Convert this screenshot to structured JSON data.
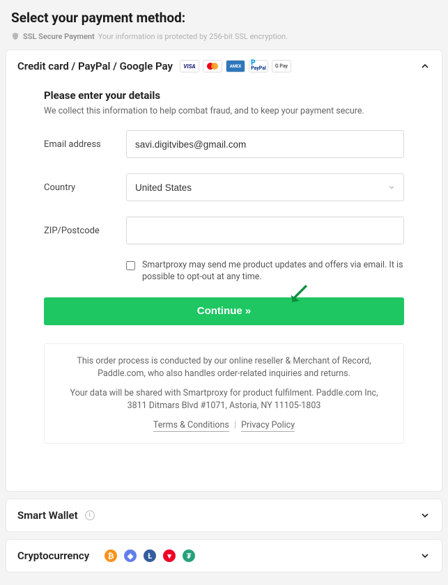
{
  "title": "Select your payment method:",
  "ssl": {
    "label": "SSL Secure Payment",
    "sub": "Your information is protected by 256-bit SSL encryption."
  },
  "card_section": {
    "label": "Credit card / PayPal / Google Pay",
    "detail_title": "Please enter your details",
    "detail_desc": "We collect this information to help combat fraud, and to keep your payment secure.",
    "labels": {
      "email": "Email address",
      "country": "Country",
      "zip": "ZIP/Postcode"
    },
    "values": {
      "email": "savi.digitvibes@gmail.com",
      "country": "United States",
      "zip": ""
    },
    "checkbox_label": "Smartproxy may send me product updates and offers via email. It is possible to opt-out at any time.",
    "continue_label": "Continue »",
    "info1": "This order process is conducted by our online reseller & Merchant of Record, Paddle.com, who also handles order-related inquiries and returns.",
    "info2": "Your data will be shared with Smartproxy for product fulfilment. Paddle.com Inc, 3811 Ditmars Blvd #1071, Astoria, NY 11105-1803",
    "terms": "Terms & Conditions",
    "privacy": "Privacy Policy"
  },
  "smart_wallet": {
    "label": "Smart Wallet"
  },
  "crypto": {
    "label": "Cryptocurrency"
  }
}
